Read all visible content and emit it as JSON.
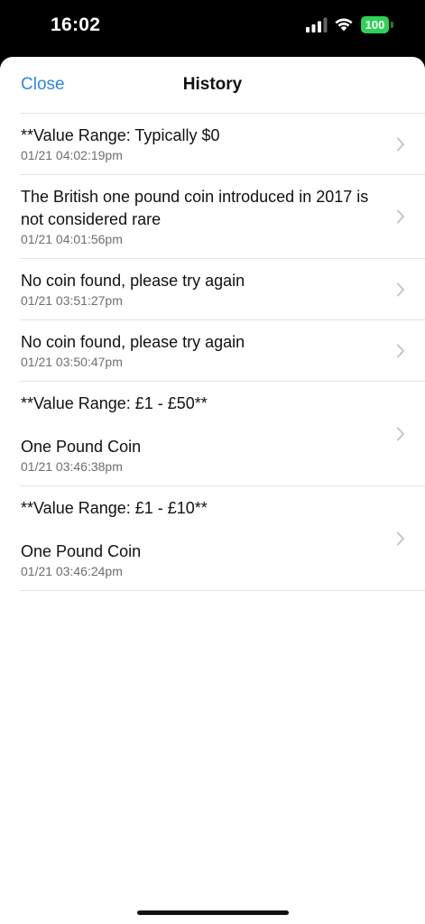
{
  "status_bar": {
    "time": "16:02",
    "battery": "100",
    "battery_color": "#30d158"
  },
  "nav": {
    "close_label": "Close",
    "title": "History",
    "accent_color": "#2f86e0"
  },
  "history": {
    "items": [
      {
        "title": "**Value Range: Typically $0",
        "time": "01/21 04:02:19pm"
      },
      {
        "title": "The British one pound coin introduced in 2017 is not considered rare",
        "time": "01/21 04:01:56pm"
      },
      {
        "title": "No coin found, please try again",
        "time": "01/21 03:51:27pm"
      },
      {
        "title": "No coin found, please try again",
        "time": "01/21 03:50:47pm"
      },
      {
        "title": "**Value Range: £1 - £50**\n\nOne Pound Coin",
        "time": "01/21 03:46:38pm"
      },
      {
        "title": "**Value Range: £1 - £10**\n\nOne Pound Coin",
        "time": "01/21 03:46:24pm"
      }
    ]
  }
}
